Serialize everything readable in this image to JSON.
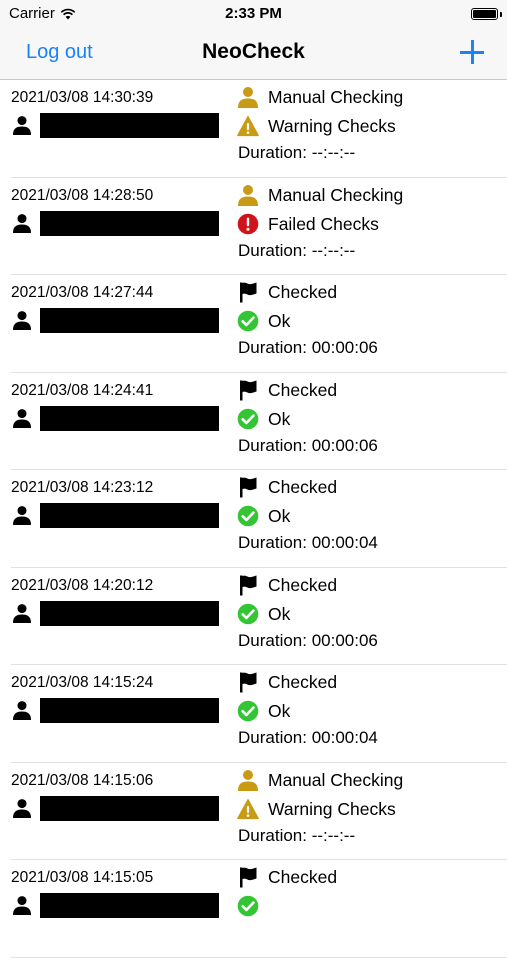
{
  "status_bar": {
    "carrier": "Carrier",
    "time": "2:33 PM"
  },
  "nav": {
    "logout_label": "Log out",
    "title": "NeoCheck",
    "add_icon": "plus-icon"
  },
  "colors": {
    "accent": "#1a82fb",
    "manual": "#c99a13",
    "warning": "#c99a13",
    "failed": "#d0121b",
    "ok": "#34c534"
  },
  "checks": [
    {
      "timestamp": "2021/03/08 14:30:39",
      "type_icon": "manual",
      "type_label": "Manual Checking",
      "result_icon": "warning",
      "result_label": "Warning Checks",
      "duration": "Duration: --:--:--"
    },
    {
      "timestamp": "2021/03/08 14:28:50",
      "type_icon": "manual",
      "type_label": "Manual Checking",
      "result_icon": "failed",
      "result_label": "Failed Checks",
      "duration": "Duration: --:--:--"
    },
    {
      "timestamp": "2021/03/08 14:27:44",
      "type_icon": "flag",
      "type_label": "Checked",
      "result_icon": "ok",
      "result_label": "Ok",
      "duration": "Duration: 00:00:06"
    },
    {
      "timestamp": "2021/03/08 14:24:41",
      "type_icon": "flag",
      "type_label": "Checked",
      "result_icon": "ok",
      "result_label": "Ok",
      "duration": "Duration: 00:00:06"
    },
    {
      "timestamp": "2021/03/08 14:23:12",
      "type_icon": "flag",
      "type_label": "Checked",
      "result_icon": "ok",
      "result_label": "Ok",
      "duration": "Duration: 00:00:04"
    },
    {
      "timestamp": "2021/03/08 14:20:12",
      "type_icon": "flag",
      "type_label": "Checked",
      "result_icon": "ok",
      "result_label": "Ok",
      "duration": "Duration: 00:00:06"
    },
    {
      "timestamp": "2021/03/08 14:15:24",
      "type_icon": "flag",
      "type_label": "Checked",
      "result_icon": "ok",
      "result_label": "Ok",
      "duration": "Duration: 00:00:04"
    },
    {
      "timestamp": "2021/03/08 14:15:06",
      "type_icon": "manual",
      "type_label": "Manual Checking",
      "result_icon": "warning",
      "result_label": "Warning Checks",
      "duration": "Duration: --:--:--"
    },
    {
      "timestamp": "2021/03/08 14:15:05",
      "type_icon": "flag",
      "type_label": "Checked",
      "result_icon": "ok",
      "result_label": "",
      "duration": ""
    }
  ]
}
